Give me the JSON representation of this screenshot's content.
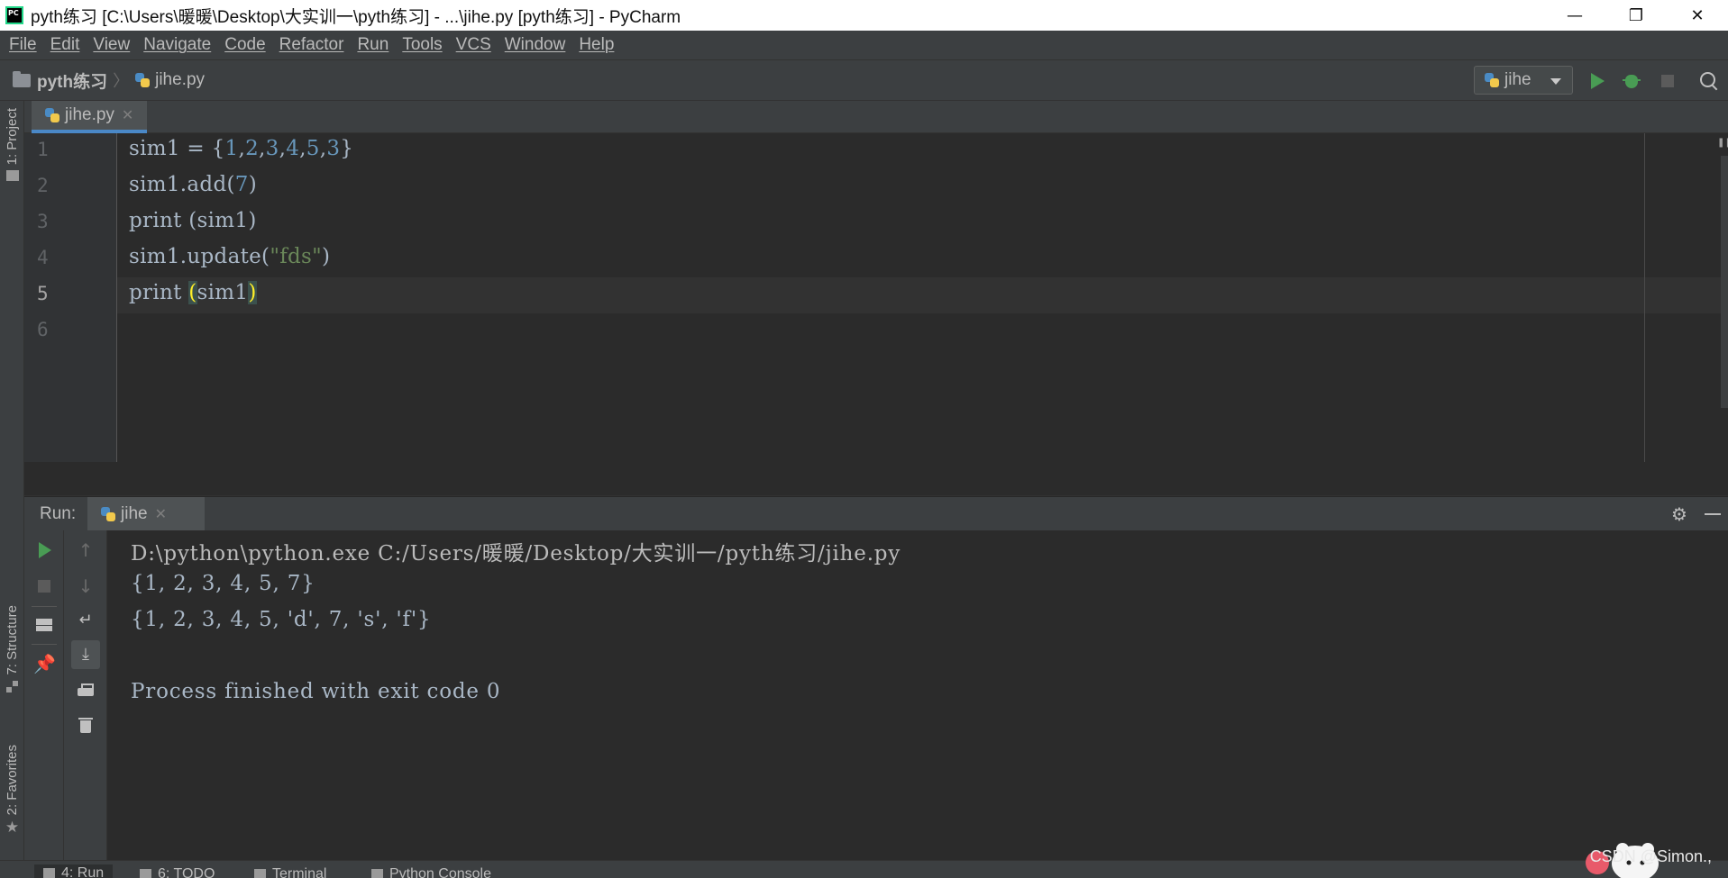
{
  "window": {
    "title": "pyth练习 [C:\\Users\\暖暖\\Desktop\\大实训一\\pyth练习] - ...\\jihe.py [pyth练习] - PyCharm",
    "minimize": "—",
    "restore": "❐",
    "close": "✕"
  },
  "menu": [
    "File",
    "Edit",
    "View",
    "Navigate",
    "Code",
    "Refactor",
    "Run",
    "Tools",
    "VCS",
    "Window",
    "Help"
  ],
  "breadcrumb": {
    "project": "pyth练习",
    "separator": "〉",
    "file": "jihe.py"
  },
  "run_config": {
    "name": "jihe"
  },
  "left_strip": {
    "project": "1: Project",
    "structure": "7: Structure",
    "favorites": "2: Favorites"
  },
  "editor": {
    "tab": {
      "label": "jihe.py",
      "close": "✕"
    },
    "line_numbers": [
      "1",
      "2",
      "3",
      "4",
      "5",
      "6"
    ],
    "current_line": 5,
    "lines": [
      {
        "parts": [
          {
            "t": "sim1 = {"
          },
          {
            "t": "1",
            "c": "num"
          },
          {
            "t": ","
          },
          {
            "t": "2",
            "c": "num"
          },
          {
            "t": ","
          },
          {
            "t": "3",
            "c": "num"
          },
          {
            "t": ","
          },
          {
            "t": "4",
            "c": "num"
          },
          {
            "t": ","
          },
          {
            "t": "5",
            "c": "num"
          },
          {
            "t": ","
          },
          {
            "t": "3",
            "c": "num"
          },
          {
            "t": "}"
          }
        ]
      },
      {
        "parts": [
          {
            "t": "sim1.add("
          },
          {
            "t": "7",
            "c": "num"
          },
          {
            "t": ")"
          }
        ]
      },
      {
        "parts": [
          {
            "t": "print (sim1)"
          }
        ]
      },
      {
        "parts": [
          {
            "t": "sim1.update("
          },
          {
            "t": "\"fds\"",
            "c": "str"
          },
          {
            "t": ")"
          }
        ]
      },
      {
        "parts": [
          {
            "t": "print "
          },
          {
            "t": "(",
            "c": "match"
          },
          {
            "t": "sim1"
          },
          {
            "t": ")",
            "c": "match"
          }
        ]
      },
      {
        "parts": [
          {
            "t": ""
          }
        ]
      }
    ]
  },
  "run_panel": {
    "title": "Run:",
    "tab": "jihe",
    "tab_close": "✕",
    "console": [
      "D:\\python\\python.exe C:/Users/暖暖/Desktop/大实训一/pyth练习/jihe.py",
      "{1, 2, 3, 4, 5, 7}",
      "{1, 2, 3, 4, 5, 'd', 7, 's', 'f'}",
      "",
      "Process finished with exit code 0"
    ]
  },
  "bottom_tabs": [
    "4: Run",
    "6: TODO",
    "Terminal",
    "Python Console"
  ],
  "watermark": "CSDN @Simon.,"
}
